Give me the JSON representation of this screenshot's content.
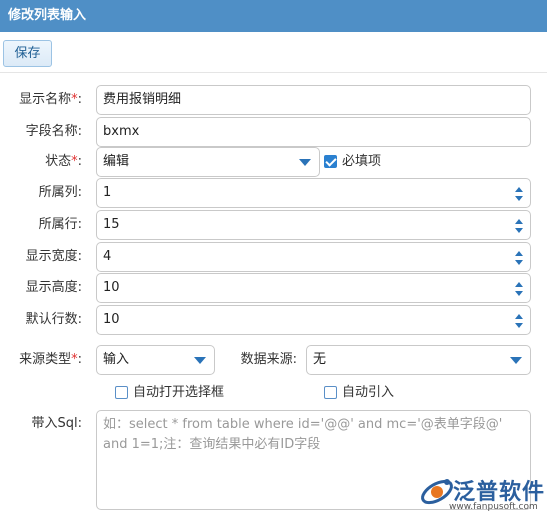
{
  "window": {
    "title": "修改列表输入"
  },
  "toolbar": {
    "save_label": "保存"
  },
  "form": {
    "display_name": {
      "label": "显示名称",
      "required_mark": "*",
      "colon": ":",
      "value": "费用报销明细"
    },
    "field_name": {
      "label": "字段名称:",
      "value": "bxmx"
    },
    "status": {
      "label": "状态",
      "required_mark": "*",
      "colon": ":",
      "value": "编辑"
    },
    "required_check": {
      "label": "必填项",
      "checked": true
    },
    "column": {
      "label": "所属列:",
      "value": "1"
    },
    "row": {
      "label": "所属行:",
      "value": "15"
    },
    "width": {
      "label": "显示宽度:",
      "value": "4"
    },
    "height": {
      "label": "显示高度:",
      "value": "10"
    },
    "default_rows": {
      "label": "默认行数:",
      "value": "10"
    },
    "source_type": {
      "label": "来源类型",
      "required_mark": "*",
      "colon": ":",
      "value": "输入"
    },
    "data_source": {
      "label": "数据来源:",
      "value": "无"
    },
    "auto_open_select": {
      "label": "自动打开选择框",
      "checked": false
    },
    "auto_import": {
      "label": "自动引入",
      "checked": false
    },
    "sql": {
      "label": "带入Sql:",
      "placeholder": "如：select * from table where id='@@' and mc='@表单字段@' and 1=1;注：查询结果中必有ID字段"
    }
  },
  "watermark": {
    "name": "泛普软件",
    "url": "www.fanpusoft.com"
  },
  "colors": {
    "titlebar": "#4f8fc6",
    "accent": "#2a73b8",
    "required": "#e03030"
  }
}
